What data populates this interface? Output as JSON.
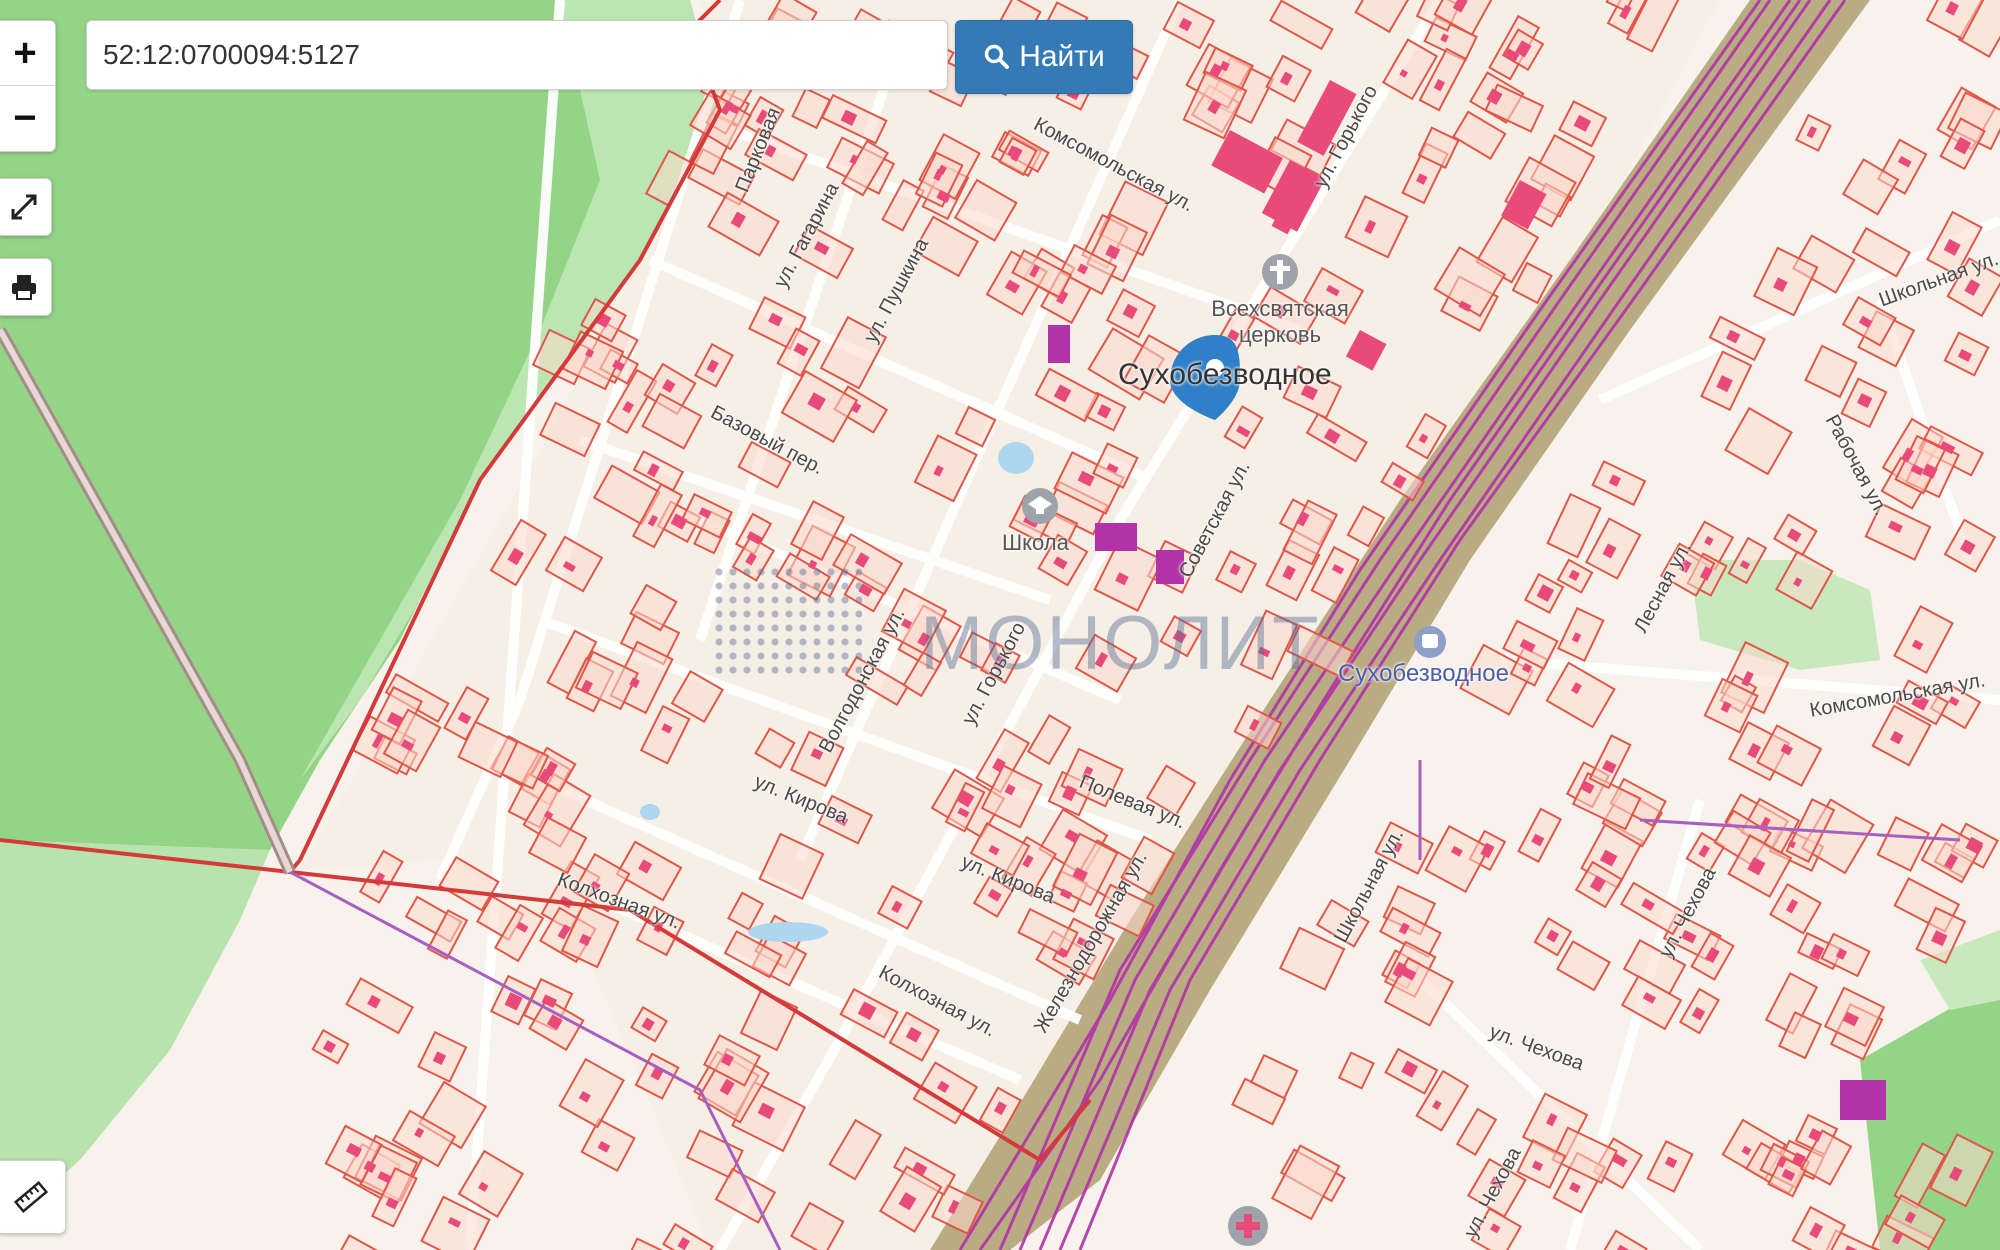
{
  "search": {
    "value": "52:12:0700094:5127",
    "button_label": "Найти"
  },
  "controls": {
    "zoom_in": "+",
    "zoom_out": "−"
  },
  "map": {
    "place_name": "Сухобезводное",
    "station_name": "Сухобезводное",
    "watermark": "МОНОЛИТ",
    "church_label": "Всехсвятская церковь",
    "school_label": "Школа",
    "streets": {
      "parkovaya": "Парковая",
      "komsomolskaya_top": "Комсомольская ул.",
      "gorkogo_top": "ул. Горького",
      "pushkina": "ул. Пушкина",
      "gagarina": "ул. Гагарина",
      "bazovy": "Базовый пер.",
      "sovetskaya": "Советская ул.",
      "volgodonskaya": "Волгодонская ул.",
      "gorkogo_mid": "ул. Горького",
      "polevaya": "Полевая ул.",
      "kirova_left": "ул. Кирова",
      "kirova_mid": "ул. Кирова",
      "kolkhoznaya_left": "Колхозная ул.",
      "kolkhoznaya_mid": "Колхозная ул.",
      "zheleznodorozhnaya": "Железнодорожная ул.",
      "shkolnaya": "Школьная ул.",
      "lesnaya": "Лесная ул.",
      "rabochaya": "Рабочая ул.",
      "shkolnaya_right": "Школьная ул.",
      "komsomolskaya_right": "Комсомольская ул.",
      "chekhova_upper": "ул. Чехова",
      "chekhova_mid": "ул. Чехова",
      "chekhova_bottom": "ул. Чехова"
    },
    "colors": {
      "forest": "#93d487",
      "background": "#f7f3ec",
      "parcel_fill": "#fbd9cc",
      "parcel_stroke": "#e0574a",
      "building": "#e84a7a",
      "railway": "#b9ab82",
      "rail_lines": "#b233a8",
      "marker": "#2f80c8",
      "boundary": "#d43a3a"
    }
  }
}
